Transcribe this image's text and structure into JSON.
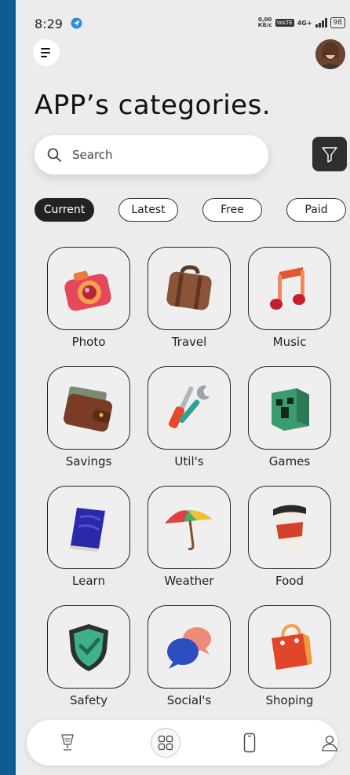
{
  "status_bar": {
    "time": "8:29",
    "speed_value": "0,00",
    "speed_unit": "КБ/с",
    "volte": "VoLTE",
    "network": "4G+",
    "battery": "98"
  },
  "header": {
    "title": "APP’s categories."
  },
  "search": {
    "placeholder": "Search"
  },
  "chips": [
    {
      "label": "Current",
      "active": true
    },
    {
      "label": "Latest",
      "active": false
    },
    {
      "label": "Free",
      "active": false
    },
    {
      "label": "Paid",
      "active": false
    }
  ],
  "categories": [
    {
      "label": "Photo",
      "icon": "camera-icon"
    },
    {
      "label": "Travel",
      "icon": "suitcase-icon"
    },
    {
      "label": "Music",
      "icon": "music-note-icon"
    },
    {
      "label": "Savings",
      "icon": "wallet-icon"
    },
    {
      "label": "Util's",
      "icon": "tools-icon"
    },
    {
      "label": "Games",
      "icon": "creeper-icon"
    },
    {
      "label": "Learn",
      "icon": "book-icon"
    },
    {
      "label": "Weather",
      "icon": "umbrella-icon"
    },
    {
      "label": "Food",
      "icon": "coffee-cup-icon"
    },
    {
      "label": "Safety",
      "icon": "shield-icon"
    },
    {
      "label": "Social's",
      "icon": "chat-bubbles-icon"
    },
    {
      "label": "Shoping",
      "icon": "shopping-bag-icon"
    }
  ],
  "bottom_nav": [
    {
      "icon": "trophy-icon",
      "active": false
    },
    {
      "icon": "grid-icon",
      "active": true
    },
    {
      "icon": "phone-icon",
      "active": false
    },
    {
      "icon": "profile-icon",
      "active": false
    }
  ],
  "colors": {
    "background": "#ececec",
    "frame": "#0d5c96",
    "accent_dark": "#222222"
  }
}
